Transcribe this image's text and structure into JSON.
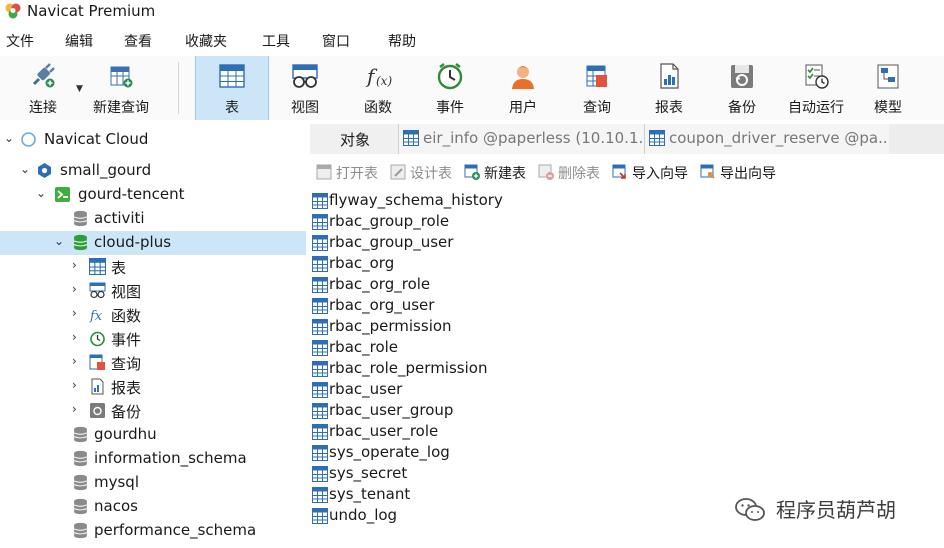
{
  "app": {
    "title": "Navicat Premium"
  },
  "menu": [
    "文件",
    "编辑",
    "查看",
    "收藏夹",
    "工具",
    "窗口",
    "帮助"
  ],
  "toolbar": {
    "items": [
      {
        "label": "连接",
        "icon": "plug-icon"
      },
      {
        "label": "新建查询",
        "icon": "new-query-icon"
      },
      {
        "label": "表",
        "icon": "table-icon",
        "active": true
      },
      {
        "label": "视图",
        "icon": "view-icon"
      },
      {
        "label": "函数",
        "icon": "function-icon"
      },
      {
        "label": "事件",
        "icon": "clock-icon"
      },
      {
        "label": "用户",
        "icon": "user-icon"
      },
      {
        "label": "查询",
        "icon": "query-icon"
      },
      {
        "label": "报表",
        "icon": "report-icon"
      },
      {
        "label": "备份",
        "icon": "backup-icon"
      },
      {
        "label": "自动运行",
        "icon": "automation-icon"
      },
      {
        "label": "模型",
        "icon": "model-icon"
      }
    ]
  },
  "tree": {
    "cloud": "Navicat Cloud",
    "project": "small_gourd",
    "connection": "gourd-tencent",
    "databases": [
      "activiti",
      "cloud-plus",
      "gourdhu",
      "information_schema",
      "mysql",
      "nacos",
      "performance_schema"
    ],
    "selected_db": "cloud-plus",
    "db_children": [
      "表",
      "视图",
      "函数",
      "事件",
      "查询",
      "报表",
      "备份"
    ]
  },
  "tabs": {
    "objects": "对象",
    "tab1": "eir_info @paperless (10.10.1...",
    "tab2": "coupon_driver_reserve @pa..."
  },
  "object_toolbar": {
    "open": "打开表",
    "design": "设计表",
    "new": "新建表",
    "delete": "删除表",
    "import": "导入向导",
    "export": "导出向导"
  },
  "tables": [
    "flyway_schema_history",
    "rbac_group_role",
    "rbac_group_user",
    "rbac_org",
    "rbac_org_role",
    "rbac_org_user",
    "rbac_permission",
    "rbac_role",
    "rbac_role_permission",
    "rbac_user",
    "rbac_user_group",
    "rbac_user_role",
    "sys_operate_log",
    "sys_secret",
    "sys_tenant",
    "undo_log"
  ],
  "watermark": "程序员葫芦胡",
  "colors": {
    "selection": "#cce6f8",
    "active_tool": "#cde6f7",
    "db_green": "#3dae3d",
    "table_blue": "#2b6cb0"
  }
}
